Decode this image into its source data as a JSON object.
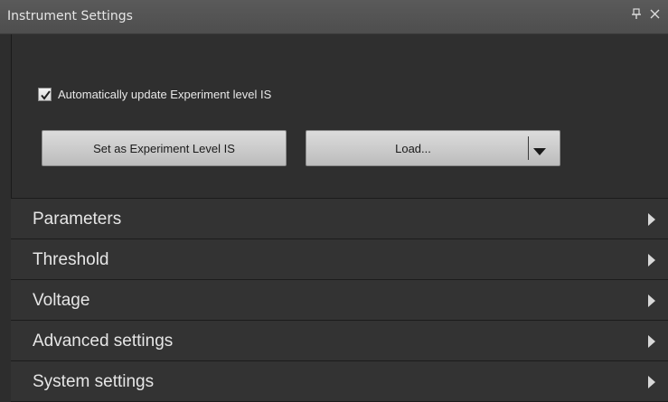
{
  "window": {
    "title": "Instrument Settings",
    "pin_glyph": "Ѩ",
    "close_glyph": "×"
  },
  "auto_update": {
    "label": "Automatically update Experiment level IS",
    "checked": true
  },
  "buttons": {
    "set_label": "Set as Experiment Level IS",
    "load_label": "Load..."
  },
  "sections": [
    {
      "label": "Parameters"
    },
    {
      "label": "Threshold"
    },
    {
      "label": "Voltage"
    },
    {
      "label": "Advanced settings"
    },
    {
      "label": "System settings"
    }
  ],
  "icons": {
    "pin": "pin-icon",
    "close": "close-icon",
    "check": "checkmark-icon",
    "dropdown": "triangle-down-icon",
    "expand": "triangle-right-icon"
  },
  "colors": {
    "panel_bg": "#2d2d2d",
    "titlebar_bg": "#545454",
    "section_bg": "#333333",
    "text": "#e6e6e6",
    "button_bg": "#cccccc"
  }
}
